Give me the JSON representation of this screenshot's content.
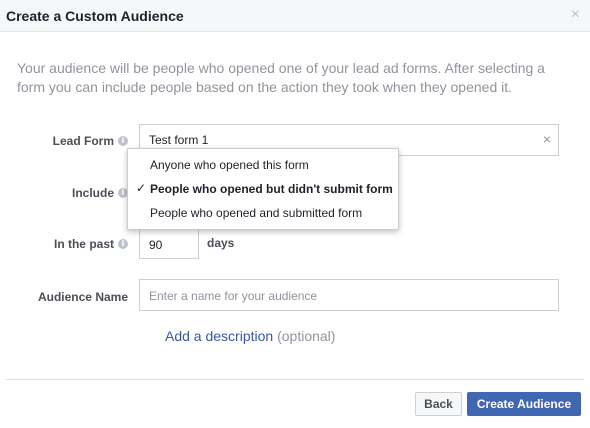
{
  "dialog": {
    "title": "Create a Custom Audience",
    "close_glyph": "×",
    "intro": "Your audience will be people who opened one of your lead ad forms. After selecting a form you can include people based on the action they took when they opened it."
  },
  "form": {
    "lead_form": {
      "label": "Lead Form",
      "value": "Test form 1",
      "clear_glyph": "×"
    },
    "include": {
      "label": "Include",
      "options": [
        {
          "text": "Anyone who opened this form",
          "selected": false
        },
        {
          "text": "People who opened but didn't submit form",
          "selected": true
        },
        {
          "text": "People who opened and submitted form",
          "selected": false
        }
      ],
      "check_glyph": "✓"
    },
    "in_the_past": {
      "label": "In the past",
      "value": "90",
      "unit": "days"
    },
    "audience_name": {
      "label": "Audience Name",
      "placeholder": "Enter a name for your audience",
      "value": ""
    },
    "description": {
      "link": "Add a description",
      "optional": "(optional)"
    }
  },
  "footer": {
    "back_label": "Back",
    "create_label": "Create Audience"
  },
  "icons": {
    "info": "info-icon",
    "close": "close-icon"
  },
  "colors": {
    "primary": "#4267b2",
    "link": "#365899",
    "muted": "#90949c"
  }
}
